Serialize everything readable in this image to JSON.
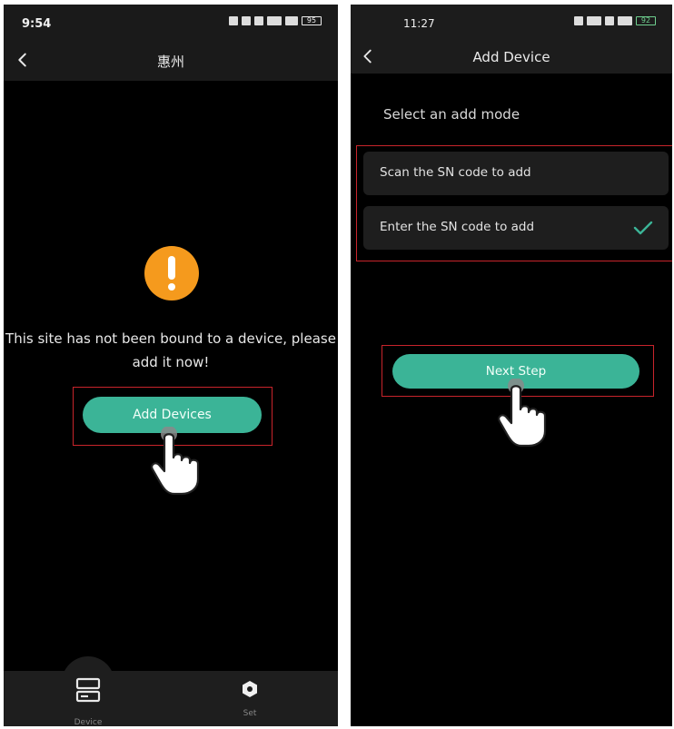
{
  "left_screen": {
    "status_time": "9:54",
    "battery": "95",
    "header_title": "惠州",
    "message": "This site has not been bound to a device, please add it now!",
    "add_button_label": "Add Devices",
    "tabs": [
      {
        "label": "Device",
        "icon": "server-icon"
      },
      {
        "label": "Set",
        "icon": "settings-icon"
      }
    ]
  },
  "right_screen": {
    "status_time": "11:27",
    "battery": "92",
    "header_title": "Add Device",
    "mode_title": "Select an add mode",
    "options": [
      {
        "label": "Scan the SN code to add",
        "selected": false
      },
      {
        "label": "Enter the SN code to add",
        "selected": true
      }
    ],
    "next_button_label": "Next Step"
  },
  "colors": {
    "accent": "#3bb497",
    "warning": "#f59a1d",
    "highlight": "#c8242b",
    "background": "#000000"
  }
}
